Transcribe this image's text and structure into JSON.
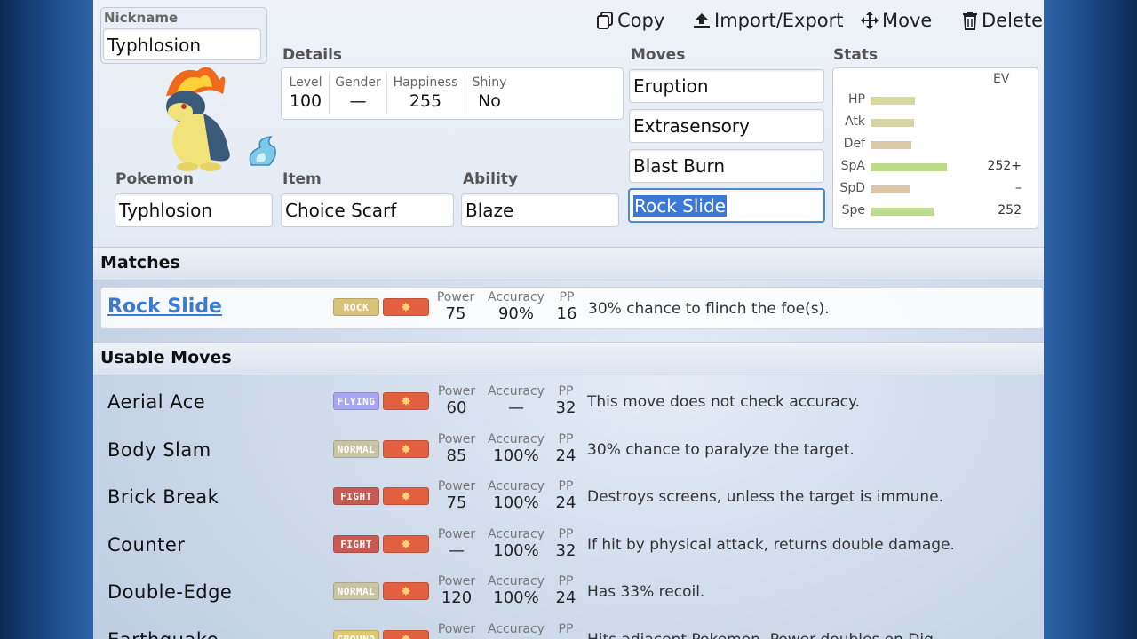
{
  "toolbar": {
    "copy_label": "Copy",
    "import_export_label": "Import/Export",
    "move_label": "Move",
    "delete_label": "Delete"
  },
  "nickname": {
    "label": "Nickname",
    "value": "Typhlosion"
  },
  "details": {
    "heading": "Details",
    "level_label": "Level",
    "level": "100",
    "gender_label": "Gender",
    "gender": "—",
    "happiness_label": "Happiness",
    "happiness": "255",
    "shiny_label": "Shiny",
    "shiny": "No"
  },
  "pokemon": {
    "label": "Pokemon",
    "value": "Typhlosion"
  },
  "item": {
    "label": "Item",
    "value": "Choice Scarf"
  },
  "ability": {
    "label": "Ability",
    "value": "Blaze"
  },
  "moves": {
    "heading": "Moves",
    "slots": [
      "Eruption",
      "Extrasensory",
      "Blast Burn",
      "Rock Slide"
    ]
  },
  "stats": {
    "heading": "Stats",
    "ev_header": "EV",
    "rows": [
      {
        "name": "HP",
        "ev": "",
        "bar_color": "#d8d99c",
        "fill": 0.5
      },
      {
        "name": "Atk",
        "ev": "",
        "bar_color": "#d6d3a6",
        "fill": 0.49
      },
      {
        "name": "Def",
        "ev": "",
        "bar_color": "#dac7a6",
        "fill": 0.46
      },
      {
        "name": "SpA",
        "ev": "252+",
        "bar_color": "#b9dc87",
        "fill": 0.86
      },
      {
        "name": "SpD",
        "ev": "–",
        "bar_color": "#dcc6ab",
        "fill": 0.44
      },
      {
        "name": "Spe",
        "ev": "252",
        "bar_color": "#bedb93",
        "fill": 0.72
      }
    ]
  },
  "matches": {
    "heading": "Matches",
    "row": {
      "name": "Rock Slide",
      "type": "ROCK",
      "type_color": "#d9c27a",
      "power_label": "Power",
      "power": "75",
      "accuracy_label": "Accuracy",
      "accuracy": "90%",
      "pp_label": "PP",
      "pp": "16",
      "desc": "30% chance to flinch the foe(s)."
    }
  },
  "usable": {
    "heading": "Usable Moves",
    "power_label": "Power",
    "accuracy_label": "Accuracy",
    "pp_label": "PP",
    "rows": [
      {
        "name": "Aerial Ace",
        "type": "FLYING",
        "type_color": "#a8a6f3",
        "power": "60",
        "accuracy": "—",
        "pp": "32",
        "desc": "This move does not check accuracy."
      },
      {
        "name": "Body Slam",
        "type": "NORMAL",
        "type_color": "#c7c5a2",
        "power": "85",
        "accuracy": "100%",
        "pp": "24",
        "desc": "30% chance to paralyze the target."
      },
      {
        "name": "Brick Break",
        "type": "FIGHT",
        "type_color": "#c75a52",
        "power": "75",
        "accuracy": "100%",
        "pp": "24",
        "desc": "Destroys screens, unless the target is immune."
      },
      {
        "name": "Counter",
        "type": "FIGHT",
        "type_color": "#c75a52",
        "power": "—",
        "accuracy": "100%",
        "pp": "32",
        "desc": "If hit by physical attack, returns double damage."
      },
      {
        "name": "Double-Edge",
        "type": "NORMAL",
        "type_color": "#c7c5a2",
        "power": "120",
        "accuracy": "100%",
        "pp": "24",
        "desc": "Has 33% recoil."
      },
      {
        "name": "Earthquake",
        "type": "GROUND",
        "type_color": "#e2c772",
        "power": "",
        "accuracy": "",
        "pp": "",
        "desc": "Hits adjacent Pokemon. Power doubles on Dig."
      }
    ]
  }
}
